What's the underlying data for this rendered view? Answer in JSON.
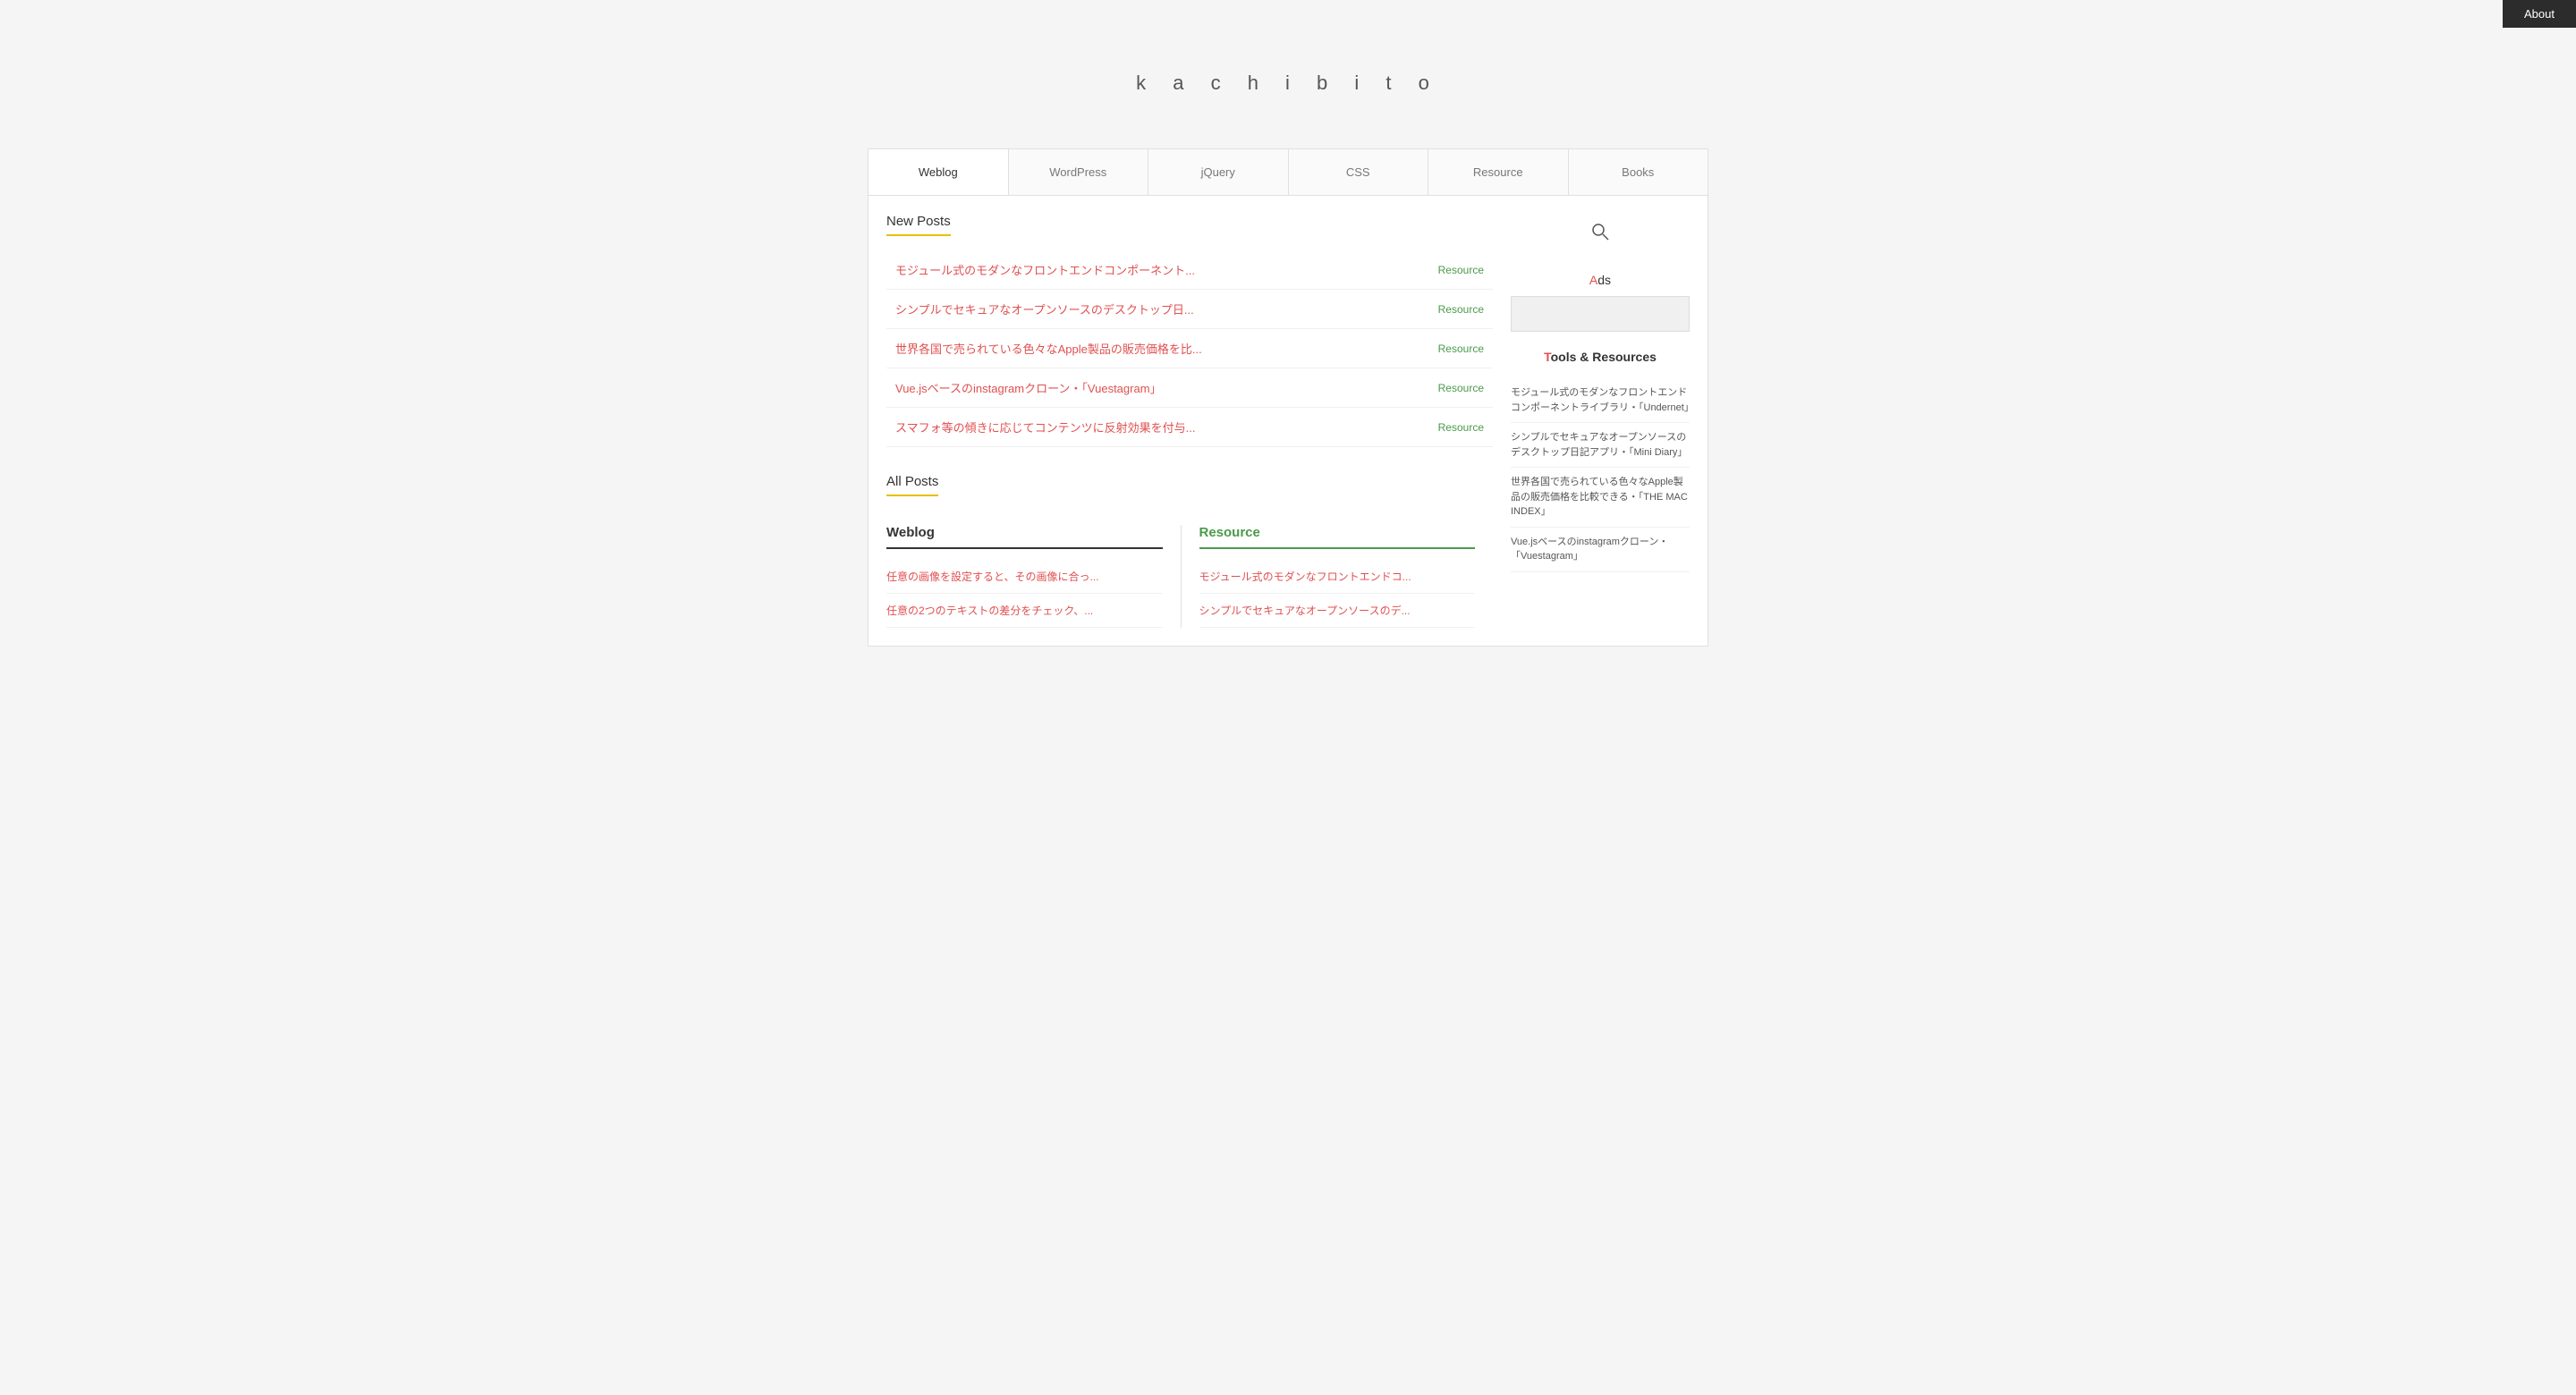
{
  "nav": {
    "about_label": "About"
  },
  "site": {
    "title": "k a c h i b i t o"
  },
  "tabs": [
    {
      "id": "weblog",
      "label": "Weblog",
      "active": true
    },
    {
      "id": "wordpress",
      "label": "WordPress",
      "active": false
    },
    {
      "id": "jquery",
      "label": "jQuery",
      "active": false
    },
    {
      "id": "css",
      "label": "CSS",
      "active": false
    },
    {
      "id": "resource",
      "label": "Resource",
      "active": false
    },
    {
      "id": "books",
      "label": "Books",
      "active": false
    }
  ],
  "new_posts": {
    "heading": "New Posts",
    "items": [
      {
        "title": "モジュール式のモダンなフロントエンドコンポーネント...",
        "tag": "Resource"
      },
      {
        "title": "シンプルでセキュアなオープンソースのデスクトップ日...",
        "tag": "Resource"
      },
      {
        "title": "世界各国で売られている色々なApple製品の販売価格を比...",
        "tag": "Resource"
      },
      {
        "title": "Vue.jsベースのinstagramクローン・「Vuestagram」",
        "tag": "Resource"
      },
      {
        "title": "スマフォ等の傾きに応じてコンテンツに反射効果を付与...",
        "tag": "Resource"
      }
    ]
  },
  "all_posts": {
    "heading": "All Posts",
    "weblog": {
      "heading": "Weblog",
      "items": [
        {
          "title": "任意の画像を設定すると、その画像に合っ..."
        },
        {
          "title": "任意の2つのテキストの差分をチェック、..."
        }
      ]
    },
    "resource": {
      "heading": "Resource",
      "items": [
        {
          "title": "モジュール式のモダンなフロントエンドコ..."
        },
        {
          "title": "シンプルでセキュアなオープンソースのデ..."
        }
      ]
    }
  },
  "sidebar": {
    "ads_label": "Ads",
    "tools_label": "Tools & Resources",
    "tools_posts": [
      {
        "title": "モジュール式のモダンなフロントエンドコンポーネントライブラリ・「Undernet」"
      },
      {
        "title": "シンプルでセキュアなオープンソースのデスクトップ日記アプリ・「Mini Diary」"
      },
      {
        "title": "世界各国で売られている色々なApple製品の販売価格を比較できる・「THE MAC INDEX」"
      },
      {
        "title": "Vue.jsベースのinstagramクローン・「Vuestagram」"
      }
    ]
  }
}
